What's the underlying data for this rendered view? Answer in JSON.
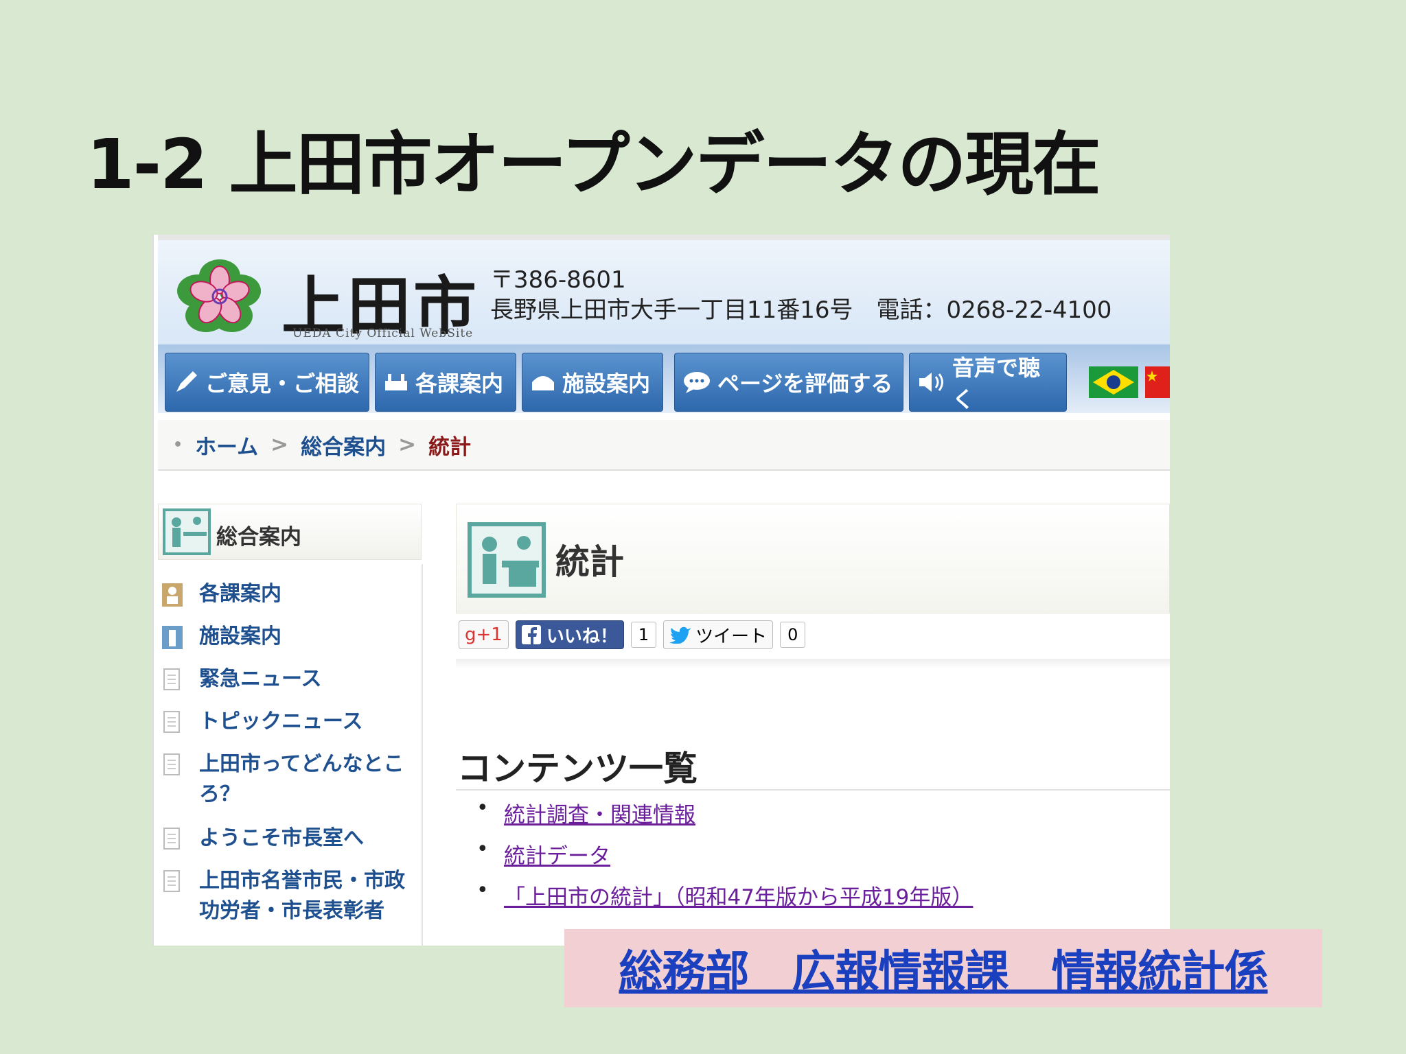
{
  "slide": {
    "title": "1-2 上田市オープンデータの現在"
  },
  "site": {
    "logo": "上田市",
    "logo_sub": "UEDA City Official WebSite",
    "postal": "〒386-8601",
    "address": "長野県上田市大手一丁目11番16号　電話：0268-22-4100"
  },
  "nav": {
    "items": [
      {
        "label": "ご意見・ご相談"
      },
      {
        "label": "各課案内"
      },
      {
        "label": "施設案内"
      },
      {
        "label": "ページを評価する"
      },
      {
        "label": "音声で聴く"
      }
    ]
  },
  "breadcrumb": {
    "home": "ホーム",
    "parent": "総合案内",
    "current": "統計"
  },
  "sidebar": {
    "heading": "総合案内",
    "items": [
      {
        "label": "各課案内",
        "icon": "person-icon"
      },
      {
        "label": "施設案内",
        "icon": "building-icon"
      },
      {
        "label": "緊急ニュース",
        "icon": "document-icon"
      },
      {
        "label": "トピックニュース",
        "icon": "document-icon"
      },
      {
        "label": "上田市ってどんなところ？",
        "icon": "document-icon"
      },
      {
        "label": "ようこそ市長室へ",
        "icon": "document-icon"
      },
      {
        "label": "上田市名誉市民・市政功労者・市長表彰者",
        "icon": "document-icon"
      }
    ]
  },
  "main": {
    "title": "統計",
    "social": {
      "gplus": "g+1",
      "like": "いいね！",
      "like_count": "1",
      "tweet": "ツイート",
      "tweet_count": "0"
    },
    "contents_heading": "コンテンツ一覧",
    "contents": [
      {
        "label": "統計調査・関連情報"
      },
      {
        "label": "統計データ"
      },
      {
        "label": "「上田市の統計」（昭和47年版から平成19年版）"
      }
    ]
  },
  "footer": {
    "department": "総務部　広報情報課　情報統計係"
  },
  "colors": {
    "background": "#d9e8d1",
    "nav_button": "#2e68ad",
    "link": "#1e4f8f",
    "visited_link": "#6b1e9c",
    "footer_box": "#f2cfd2",
    "footer_text": "#1a3fbf"
  }
}
